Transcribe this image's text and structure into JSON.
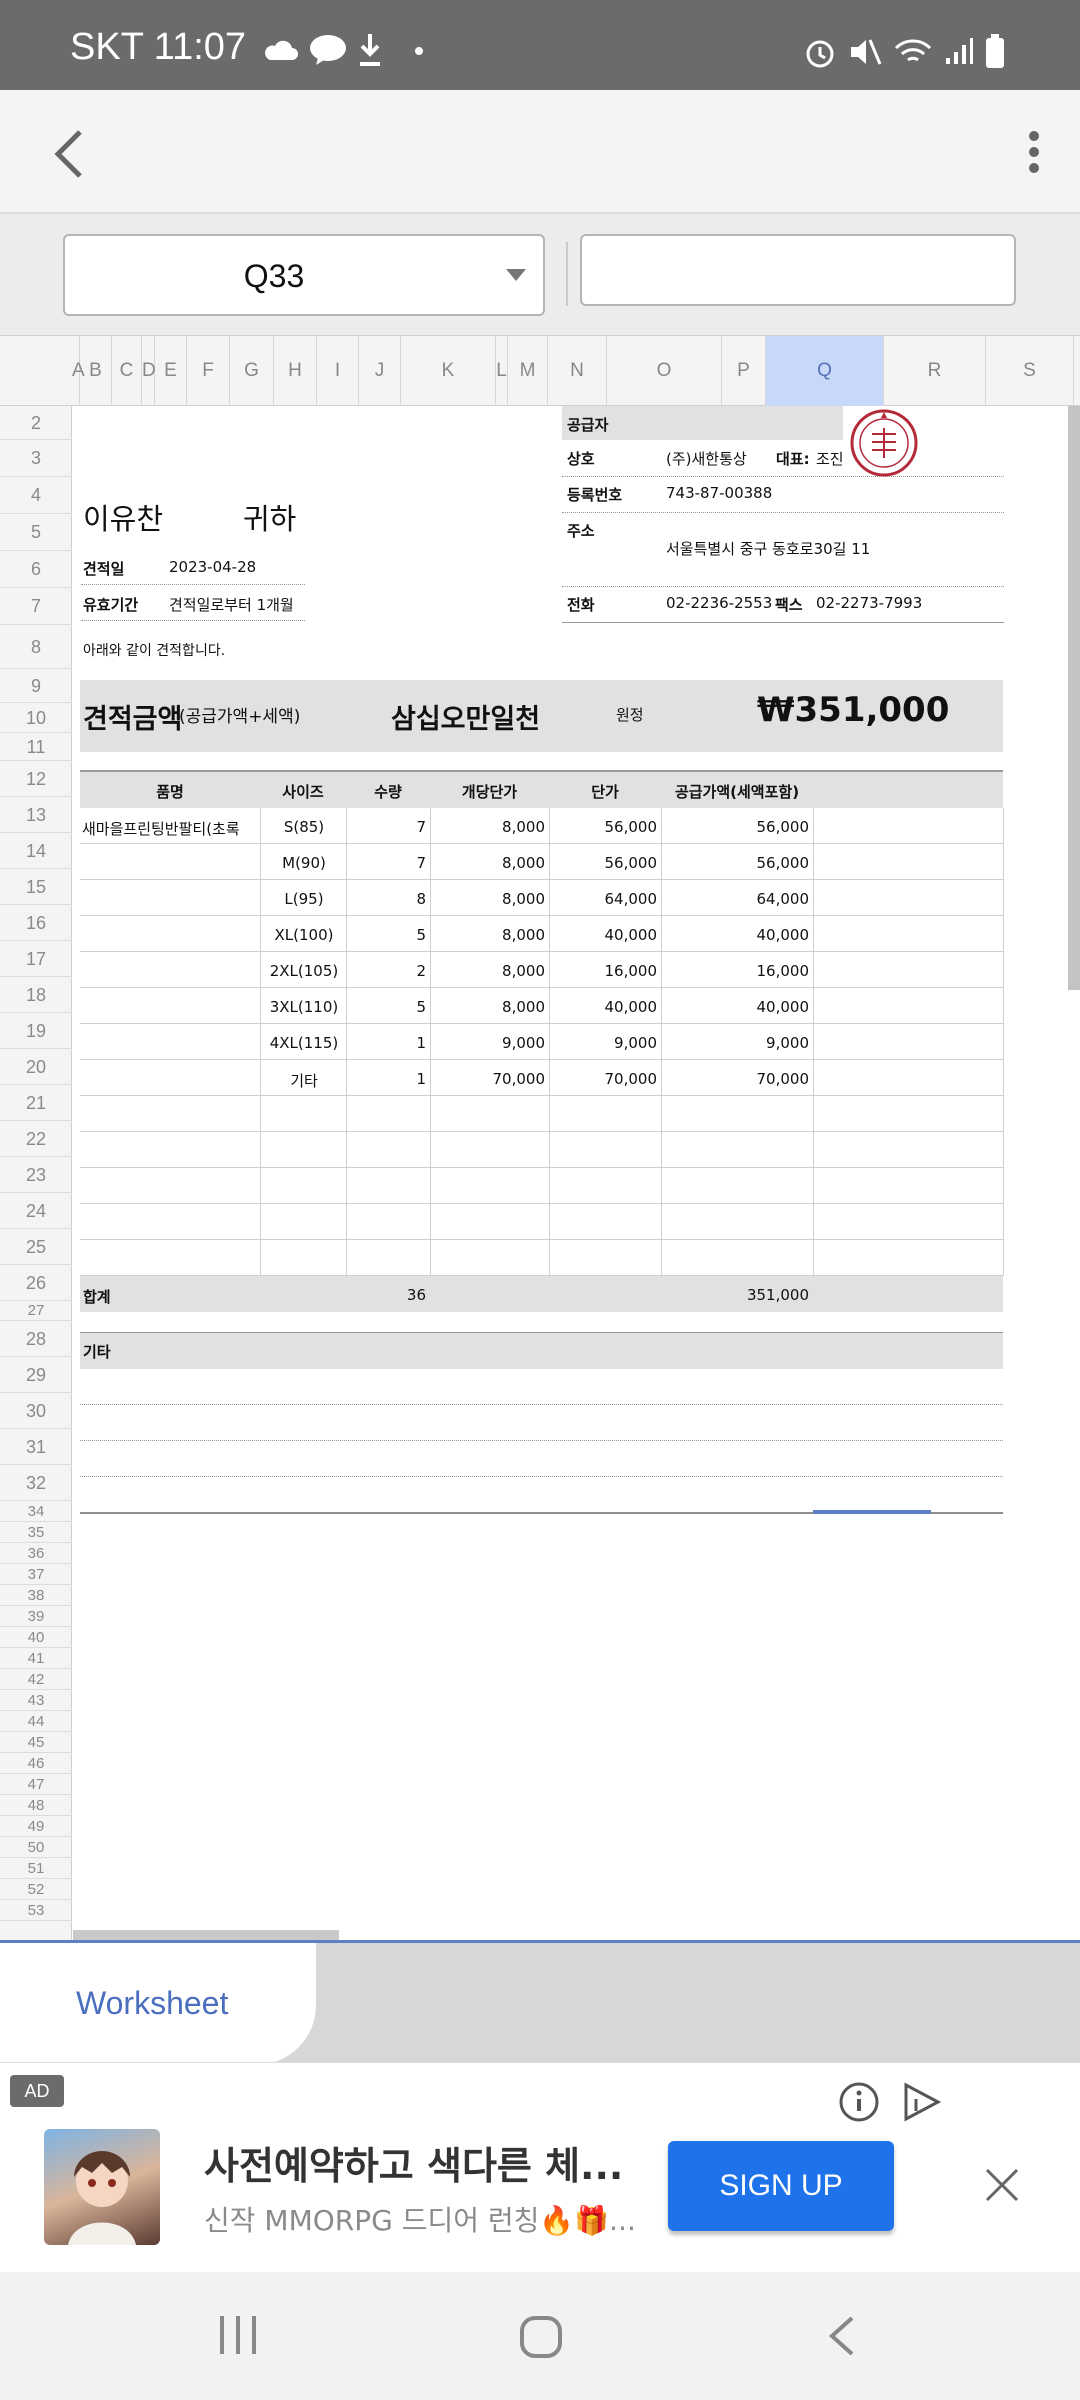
{
  "status": {
    "time": "SKT 11:07"
  },
  "formula": {
    "cell": "Q33"
  },
  "columns": [
    "A",
    "B",
    "C",
    "D",
    "E",
    "F",
    "G",
    "H",
    "I",
    "J",
    "K",
    "L",
    "M",
    "N",
    "O",
    "P",
    "Q",
    "R",
    "S"
  ],
  "rows": [
    "2",
    "3",
    "4",
    "5",
    "6",
    "7",
    "8",
    "9",
    "10",
    "11",
    "12",
    "13",
    "14",
    "15",
    "16",
    "17",
    "18",
    "19",
    "20",
    "21",
    "22",
    "23",
    "24",
    "25",
    "26",
    "27",
    "28",
    "29",
    "30",
    "31",
    "32",
    "34",
    "35",
    "36",
    "37",
    "38",
    "39",
    "40",
    "41",
    "42",
    "43",
    "44",
    "45",
    "46",
    "47",
    "48",
    "49",
    "50",
    "51",
    "52",
    "53"
  ],
  "quote": {
    "customer": "이유찬",
    "honor": "귀하",
    "date_label": "견적일",
    "date": "2023-04-28",
    "valid_label": "유효기간",
    "valid": "견적일로부터 1개월",
    "intro": "아래와 같이 견적합니다.",
    "amount_label": "견적금액",
    "amount_sub": "(공급가액+세액)",
    "amount_words": "삼십오만일천",
    "won_label": "원정",
    "amount": "₩351,000",
    "supplier_label": "공급자",
    "company_label": "상호",
    "company": "(주)새한통상",
    "rep_label": "대표:",
    "rep": "조진",
    "reg_label": "등록번호",
    "reg": "743-87-00388",
    "addr_label": "주소",
    "addr": "서울특별시 중구 동호로30길 11",
    "tel_label": "전화",
    "tel": "02-2236-2553",
    "fax_label": "팩스",
    "fax": "02-2273-7993",
    "seal": "새한통상",
    "headers": [
      "품명",
      "사이즈",
      "수량",
      "개당단가",
      "단가",
      "공급가액(세액포함)"
    ],
    "items": [
      [
        "새마을프린팅반팔티(초록",
        "S(85)",
        "7",
        "8,000",
        "56,000",
        "56,000"
      ],
      [
        "",
        "M(90)",
        "7",
        "8,000",
        "56,000",
        "56,000"
      ],
      [
        "",
        "L(95)",
        "8",
        "8,000",
        "64,000",
        "64,000"
      ],
      [
        "",
        "XL(100)",
        "5",
        "8,000",
        "40,000",
        "40,000"
      ],
      [
        "",
        "2XL(105)",
        "2",
        "8,000",
        "16,000",
        "16,000"
      ],
      [
        "",
        "3XL(110)",
        "5",
        "8,000",
        "40,000",
        "40,000"
      ],
      [
        "",
        "4XL(115)",
        "1",
        "9,000",
        "9,000",
        "9,000"
      ],
      [
        "",
        "기타",
        "1",
        "70,000",
        "70,000",
        "70,000"
      ]
    ],
    "total_label": "합계",
    "total_qty": "36",
    "total_amount": "351,000",
    "etc_label": "기타"
  },
  "tabs": {
    "sheet": "Worksheet"
  },
  "ad": {
    "badge": "AD",
    "title": "사전예약하고 색다른 체...",
    "subtitle": "신작 MMORPG 드디어 런칭🔥🎁...",
    "cta": "SIGN UP"
  }
}
